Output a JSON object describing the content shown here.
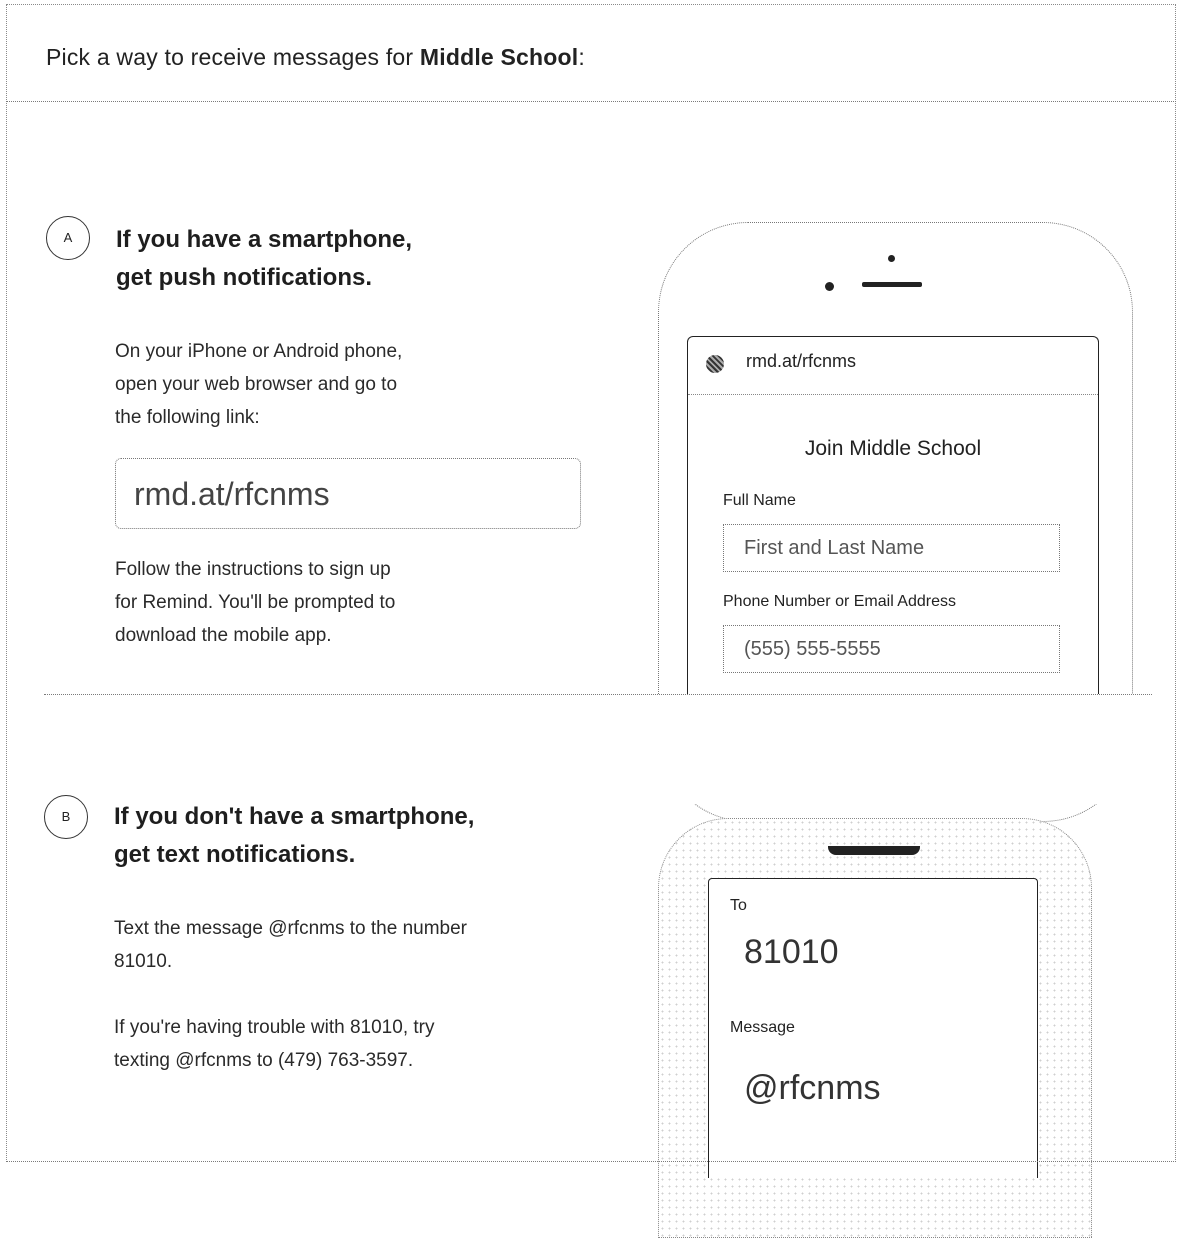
{
  "header": {
    "prefix": "Pick a way to receive messages for ",
    "class_name": "Middle School",
    "suffix": ":"
  },
  "option_a": {
    "badge": "A",
    "heading_line1": "If you have a smartphone,",
    "heading_line2": "get push notifications.",
    "instructions": [
      "On your iPhone or Android phone,",
      "open your web browser and go to",
      "the following link:"
    ],
    "link": "rmd.at/rfcnms",
    "followup": [
      "Follow the instructions to sign up",
      "for Remind. You'll be prompted to",
      "download the mobile app."
    ],
    "phone_screen": {
      "url": "rmd.at/rfcnms",
      "title": "Join Middle School",
      "full_name_label": "Full Name",
      "full_name_placeholder": "First and Last Name",
      "contact_label": "Phone Number or Email Address",
      "contact_placeholder": "(555) 555-5555"
    }
  },
  "option_b": {
    "badge": "B",
    "heading_line1": "If you don't have a smartphone,",
    "heading_line2": "get text notifications.",
    "instructions": [
      "Text the message @rfcnms to the number",
      "81010."
    ],
    "trouble": [
      "If you're having trouble with 81010, try",
      "texting @rfcnms to (479) 763-3597."
    ],
    "phone_screen": {
      "to_label": "To",
      "to_value": "81010",
      "message_label": "Message",
      "message_value": "@rfcnms"
    }
  }
}
